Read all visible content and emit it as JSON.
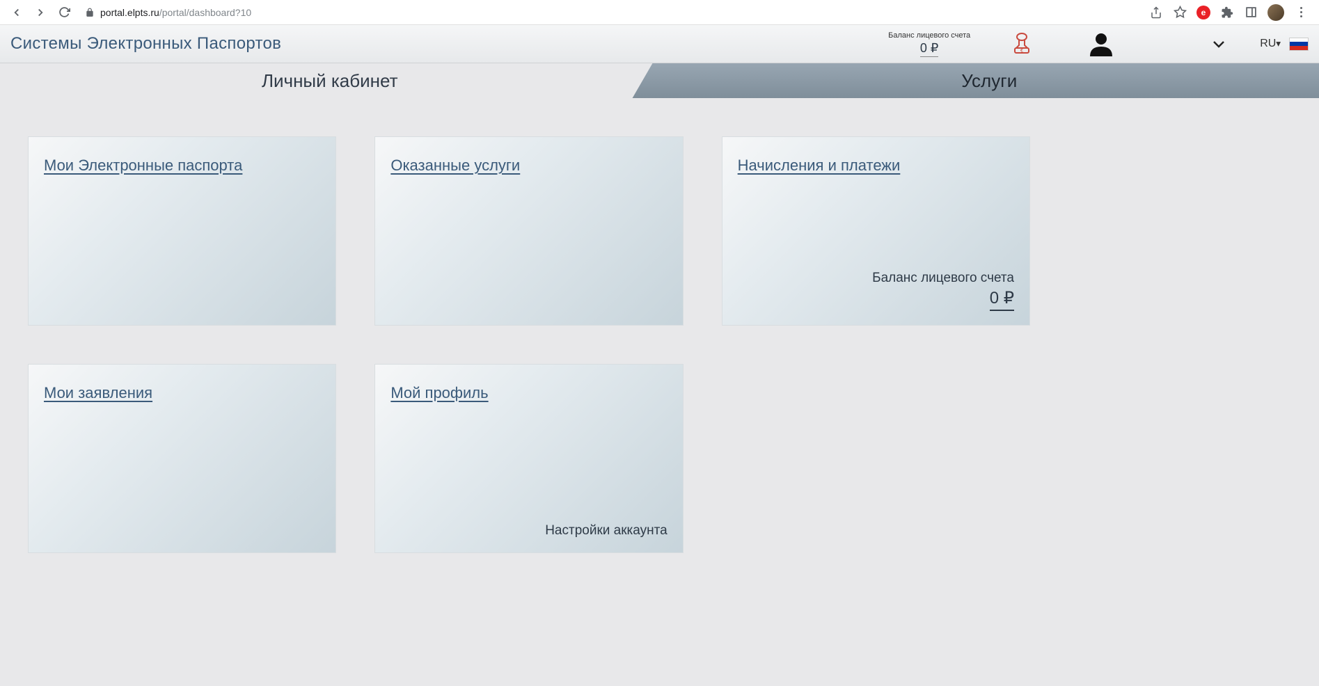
{
  "browser": {
    "url_domain": "portal.elpts.ru",
    "url_path": "/portal/dashboard?10"
  },
  "header": {
    "brand": "Системы Электронных Паспортов",
    "balance_label": "Баланс лицевого счета",
    "balance_value": "0 ₽",
    "lang": "RU"
  },
  "tabs": {
    "active": "Личный кабинет",
    "inactive": "Услуги"
  },
  "cards": {
    "passports": {
      "title": "Мои Электронные паспорта"
    },
    "services": {
      "title": "Оказанные услуги"
    },
    "payments": {
      "title": "Начисления и платежи",
      "balance_label": "Баланс лицевого счета",
      "balance_value": "0 ₽"
    },
    "applications": {
      "title": "Мои заявления"
    },
    "profile": {
      "title": "Мой профиль",
      "bottom_label": "Настройки аккаунта"
    }
  }
}
